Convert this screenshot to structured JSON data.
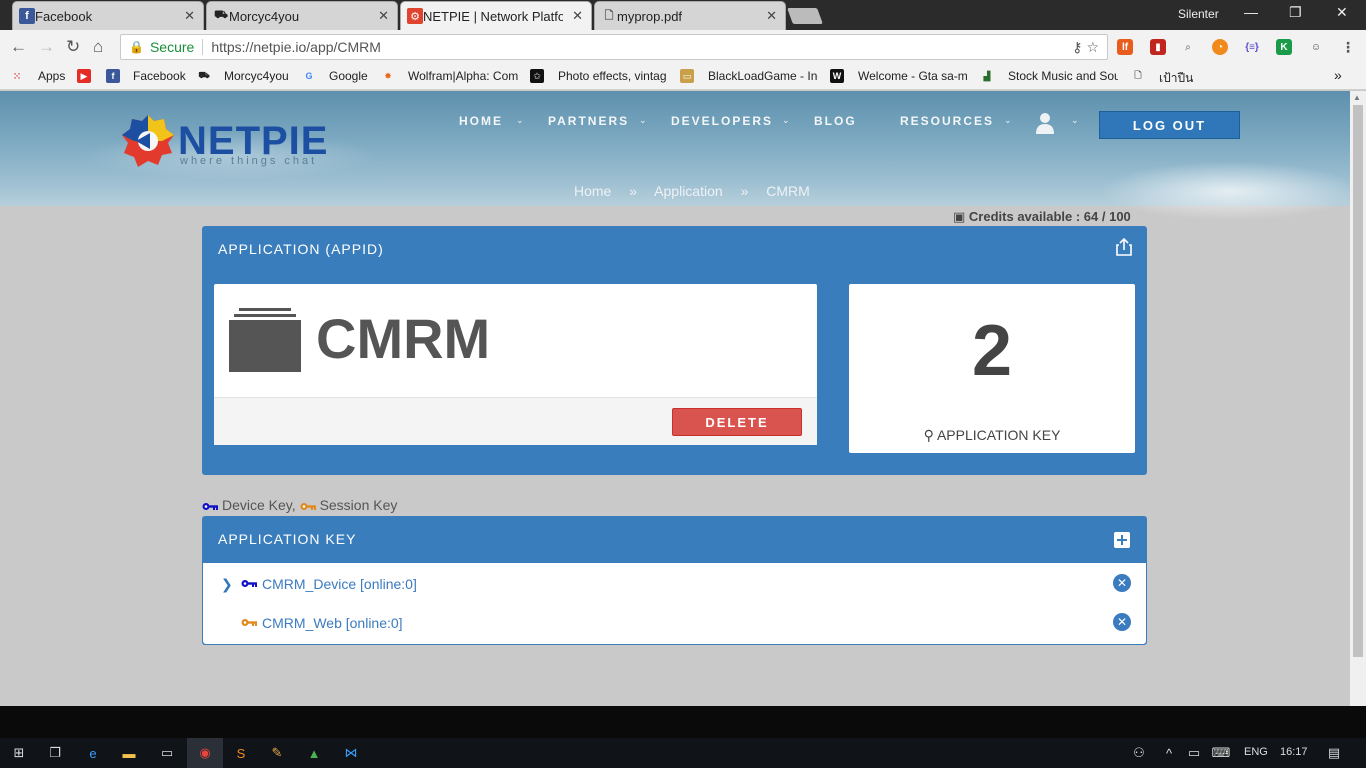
{
  "browser": {
    "tabs": [
      {
        "label": "Facebook",
        "active": false,
        "icon": "facebook-icon"
      },
      {
        "label": "Morcyc4you",
        "active": false,
        "icon": "motorcycle-icon"
      },
      {
        "label": "NETPIE | Network Platform",
        "active": true,
        "icon": "netpie-icon"
      },
      {
        "label": "myprop.pdf",
        "active": false,
        "icon": "document-icon"
      }
    ],
    "window_user": "Silenter",
    "secure_label": "Secure",
    "url": "https://netpie.io/app/CMRM",
    "bookmarks": [
      {
        "label": "Apps",
        "icon": "apps-grid-icon"
      },
      {
        "label": "",
        "icon": "youtube-icon"
      },
      {
        "label": "Facebook",
        "icon": "facebook-icon"
      },
      {
        "label": "Morcyc4you",
        "icon": "motorcycle-icon"
      },
      {
        "label": "Google",
        "icon": "google-icon"
      },
      {
        "label": "Wolfram|Alpha: Com",
        "icon": "wolfram-icon"
      },
      {
        "label": "Photo effects, vintag",
        "icon": "star-icon"
      },
      {
        "label": "BlackLoadGame - Inc",
        "icon": "game-icon"
      },
      {
        "label": "Welcome - Gta sa-m",
        "icon": "w-icon"
      },
      {
        "label": "Stock Music and Sou",
        "icon": "music-icon"
      },
      {
        "label": "เป้าปืน",
        "icon": "page-icon"
      }
    ]
  },
  "site": {
    "logo_text": "NETPIE",
    "logo_tagline": "where things chat",
    "nav": [
      "HOME",
      "PARTNERS",
      "DEVELOPERS",
      "BLOG",
      "RESOURCES"
    ],
    "logout_label": "LOG OUT",
    "breadcrumb": [
      "Home",
      "»",
      "Application",
      "»",
      "CMRM"
    ]
  },
  "credits": "Credits available : 64 / 100",
  "app_panel": {
    "title": "APPLICATION (APPID)",
    "app_name": "CMRM",
    "delete_label": "DELETE",
    "key_count": "2",
    "key_count_label": "APPLICATION KEY"
  },
  "legend": {
    "device": "Device Key,",
    "session": "Session Key"
  },
  "keys_panel": {
    "title": "APPLICATION KEY",
    "keys": [
      {
        "name": "CMRM_Device [online:0]",
        "type": "device",
        "color": "#1010c8"
      },
      {
        "name": "CMRM_Web [online:0]",
        "type": "session",
        "color": "#e08a1e"
      }
    ]
  },
  "taskbar": {
    "lang": "ENG",
    "time": "16:17"
  },
  "colors": {
    "panel_blue": "#3a7dbd",
    "delete_red": "#d9534f",
    "link_blue": "#3b7bbf"
  }
}
